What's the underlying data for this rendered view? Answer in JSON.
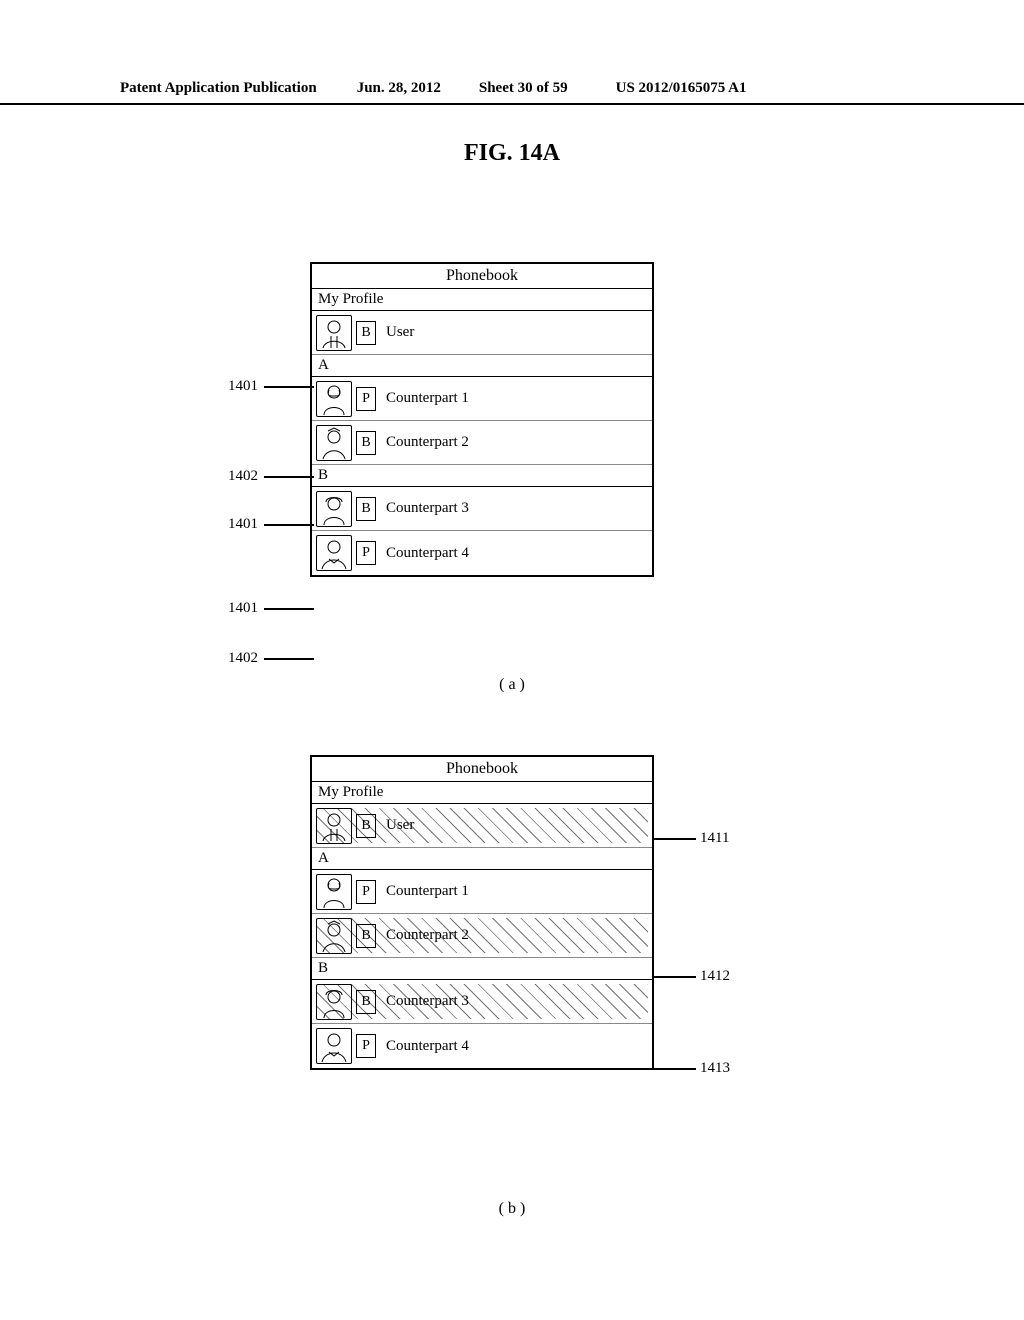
{
  "header": {
    "publication": "Patent Application Publication",
    "date": "Jun. 28, 2012",
    "sheet": "Sheet 30 of 59",
    "docnum": "US 2012/0165075 A1"
  },
  "figure_label": "FIG. 14A",
  "sub_labels": {
    "a": "( a )",
    "b": "( b )"
  },
  "phonebook_a": {
    "title": "Phonebook",
    "sections": {
      "my_profile": "My Profile",
      "sec_a": "A",
      "sec_b": "B"
    },
    "rows": {
      "user": {
        "badge": "B",
        "name": "User"
      },
      "c1": {
        "badge": "P",
        "name": "Counterpart 1"
      },
      "c2": {
        "badge": "B",
        "name": "Counterpart 2"
      },
      "c3": {
        "badge": "B",
        "name": "Counterpart 3"
      },
      "c4": {
        "badge": "P",
        "name": "Counterpart 4"
      }
    }
  },
  "phonebook_b": {
    "title": "Phonebook",
    "sections": {
      "my_profile": "My Profile",
      "sec_a": "A",
      "sec_b": "B"
    },
    "rows": {
      "user": {
        "badge": "B",
        "name": "User"
      },
      "c1": {
        "badge": "P",
        "name": "Counterpart 1"
      },
      "c2": {
        "badge": "B",
        "name": "Counterpart 2"
      },
      "c3": {
        "badge": "B",
        "name": "Counterpart 3"
      },
      "c4": {
        "badge": "P",
        "name": "Counterpart 4"
      }
    }
  },
  "callouts": {
    "c1401": "1401",
    "c1402": "1402",
    "c1411": "1411",
    "c1412": "1412",
    "c1413": "1413"
  }
}
